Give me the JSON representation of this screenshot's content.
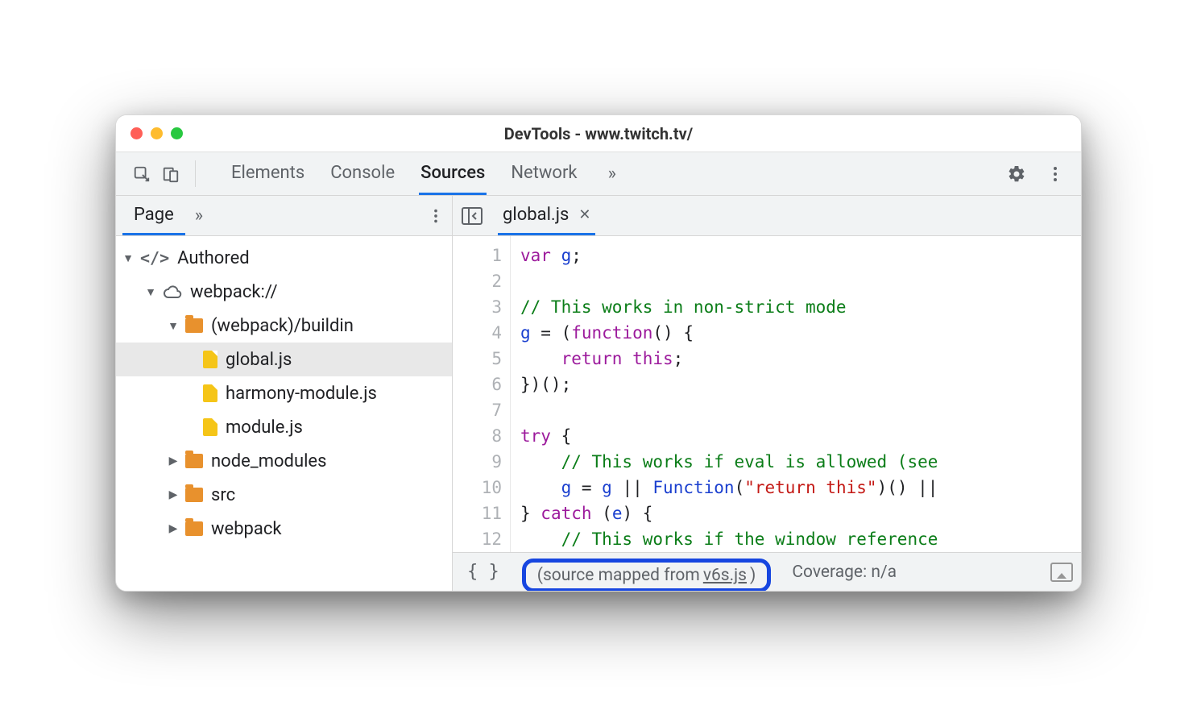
{
  "window": {
    "title": "DevTools - www.twitch.tv/"
  },
  "tabs": {
    "items": [
      "Elements",
      "Console",
      "Sources",
      "Network"
    ],
    "active": "Sources",
    "more": "»"
  },
  "sidebar": {
    "tab": "Page",
    "more": "»"
  },
  "openFile": {
    "name": "global.js"
  },
  "tree": {
    "root": {
      "label": "Authored"
    },
    "webpack": {
      "label": "webpack://"
    },
    "buildin": {
      "label": "(webpack)/buildin"
    },
    "files": {
      "global": "global.js",
      "harmony": "harmony-module.js",
      "module": "module.js"
    },
    "folders": {
      "node_modules": "node_modules",
      "src": "src",
      "webpack": "webpack"
    }
  },
  "editor": {
    "lines": [
      1,
      2,
      3,
      4,
      5,
      6,
      7,
      8,
      9,
      10,
      11,
      12
    ],
    "l1": {
      "kw": "var",
      "v": "g",
      "p": ";"
    },
    "l3": {
      "com": "// This works in non-strict mode"
    },
    "l4": {
      "v": "g",
      "eq": " = (",
      "kw": "function",
      "p": "() {"
    },
    "l5": {
      "kw": "return",
      "v": "this",
      "p": ";"
    },
    "l6": {
      "p": "})();"
    },
    "l8": {
      "kw": "try",
      "p": " {"
    },
    "l9": {
      "com": "// This works if eval is allowed (see"
    },
    "l10": {
      "v": "g",
      "a1": " = ",
      "v2": "g",
      "a2": " || ",
      "fn": "Function",
      "p1": "(",
      "str": "\"return this\"",
      "p2": ")() ||"
    },
    "l11": {
      "p1": "} ",
      "kw": "catch",
      "p2": " (",
      "v": "e",
      "p3": ") {"
    },
    "l12": {
      "com": "// This works if the window reference"
    }
  },
  "status": {
    "mappedPrefix": "(source mapped from ",
    "mappedLink": "v6s.js",
    "mappedSuffix": ")",
    "coverage": "Coverage: n/a"
  }
}
